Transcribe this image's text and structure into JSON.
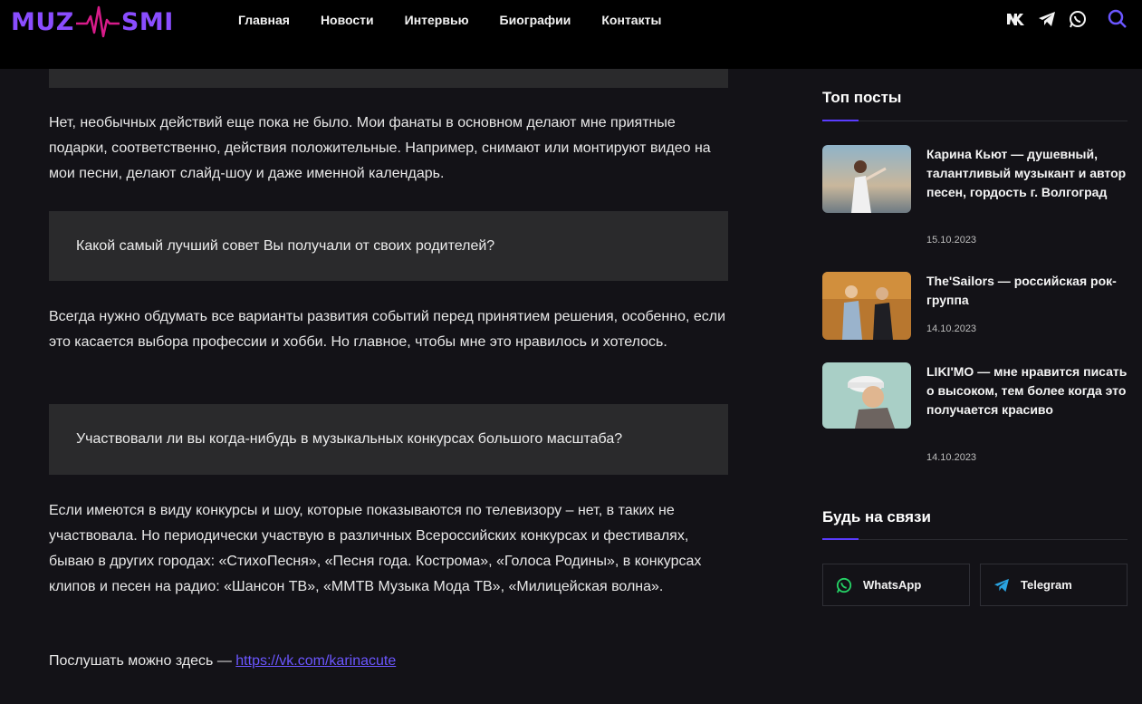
{
  "brand": {
    "logo_left": "MUZ",
    "logo_right": "SMI",
    "accent_color": "#8a4dff"
  },
  "nav": {
    "items": [
      "Главная",
      "Новости",
      "Интервью",
      "Биографии",
      "Контакты"
    ]
  },
  "social_icons": [
    "vk-icon",
    "telegram-icon",
    "whatsapp-icon",
    "search-icon"
  ],
  "article": {
    "p1": "Нет, необычных действий еще пока не было. Мои фанаты в основном делают мне приятные подарки, соответственно, действия положительные. Например, снимают или монтируют видео на мои песни, делают слайд-шоу и даже именной календарь.",
    "q1": "Какой самый лучший совет Вы получали от своих родителей?",
    "p2": "Всегда нужно обдумать все варианты развития событий перед принятием решения, особенно, если это касается выбора профессии и хобби. Но главное, чтобы мне это нравилось и хотелось.",
    "q2": "Участвовали ли вы когда-нибудь в музыкальных конкурсах большого масштаба?",
    "p3": "Если имеются в виду конкурсы и шоу, которые показываются по телевизору – нет, в таких не участвовала. Но периодически участвую в различных Всероссийских конкурсах и фестивалях, бываю в других городах: «СтихоПесня», «Песня года. Кострома», «Голоса Родины», в конкурсах клипов и песен на радио: «Шансон ТВ», «ММТВ Музыка Мода ТВ», «Милицейская волна».",
    "listen_prefix": "Послушать можно здесь — ",
    "listen_link": "https://vk.com/karinacute"
  },
  "sidebar": {
    "top_title": "Топ посты",
    "posts": [
      {
        "title": "Карина Кьют — душевный, талантливый музыкант и автор песен, гордость г. Волгоград",
        "date": "15.10.2023"
      },
      {
        "title": "The'Sailors — российская рок-группа",
        "date": "14.10.2023"
      },
      {
        "title": "LIKI'MO — мне нравится писать о высоком, тем более когда это получается красиво",
        "date": "14.10.2023"
      }
    ],
    "contact_title": "Будь на связи",
    "buttons": [
      {
        "label": "WhatsApp",
        "icon": "whatsapp-icon",
        "color": "#25d366"
      },
      {
        "label": "Telegram",
        "icon": "telegram-icon",
        "color": "#2aa3e0"
      }
    ]
  }
}
